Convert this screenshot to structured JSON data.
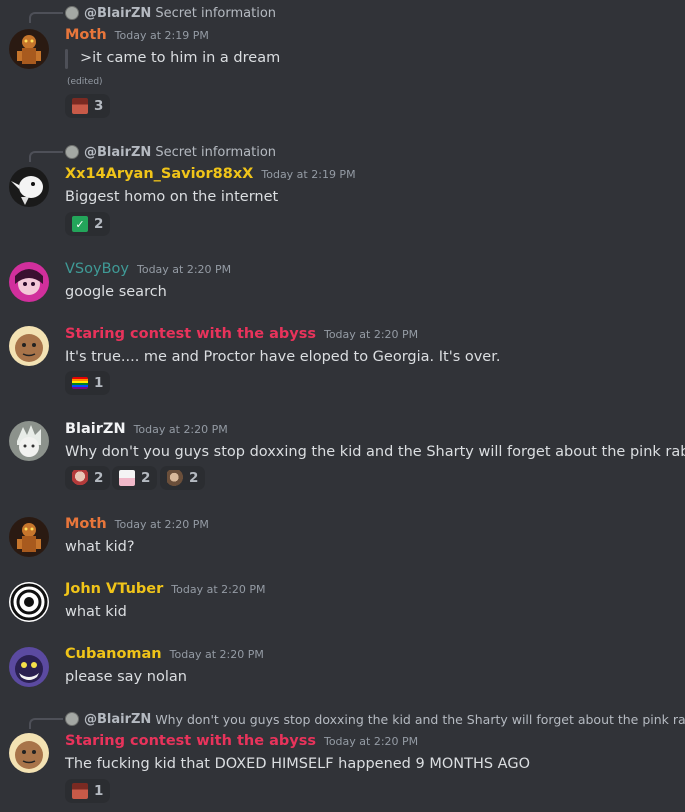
{
  "messages": [
    {
      "reply": {
        "name": "@BlairZN",
        "text": "Secret information"
      },
      "username": "Moth",
      "color": "#e8763b",
      "timestamp": "Today at 2:19 PM",
      "content": ">it came to him in a dream",
      "edited": "(edited)",
      "reactions": [
        {
          "emoji": "face-sticker-icon",
          "count": "3"
        }
      ]
    },
    {
      "reply": {
        "name": "@BlairZN",
        "text": "Secret information"
      },
      "username": "Xx14Aryan_Savior88xX",
      "color": "#f0c419",
      "timestamp": "Today at 2:19 PM",
      "content": "Biggest homo on the internet",
      "reactions": [
        {
          "emoji": "check-mark-icon",
          "count": "2"
        }
      ]
    },
    {
      "username": "VSoyBoy",
      "color": "#3f9a96",
      "timestamp": "Today at 2:20 PM",
      "content": "google search"
    },
    {
      "username": "Staring contest with the abyss",
      "color": "#e8335b",
      "timestamp": "Today at 2:20 PM",
      "content": "It's true.... me and Proctor have eloped to Georgia. It's over.",
      "reactions": [
        {
          "emoji": "rainbow-flag-icon",
          "count": "1"
        }
      ]
    },
    {
      "username": "BlairZN",
      "color": "#dbdee1",
      "timestamp": "Today at 2:20 PM",
      "content": "Why don't you guys stop doxxing the kid and the Sharty will forget about the pink rabbit",
      "reactions": [
        {
          "emoji": "anime-sticker-icon",
          "count": "2"
        },
        {
          "emoji": "pink-rabbit-sticker-icon",
          "count": "2"
        },
        {
          "emoji": "pointing-sticker-icon",
          "count": "2"
        }
      ]
    },
    {
      "username": "Moth",
      "color": "#e8763b",
      "timestamp": "Today at 2:20 PM",
      "content": "what kid?"
    },
    {
      "username": "John VTuber",
      "color": "#f0c419",
      "timestamp": "Today at 2:20 PM",
      "content": "what kid"
    },
    {
      "username": "Cubanoman",
      "color": "#f0c419",
      "timestamp": "Today at 2:20 PM",
      "content": "please say nolan"
    },
    {
      "reply": {
        "name": "@BlairZN",
        "text": "Why don't you guys stop doxxing the kid and the Sharty will forget about the pink rabbit"
      },
      "username": "Staring contest with the abyss",
      "color": "#e8335b",
      "timestamp": "Today at 2:20 PM",
      "content": "The fucking kid that DOXED HIMSELF happened 9 MONTHS AGO",
      "reactions": [
        {
          "emoji": "face-sticker-icon",
          "count": "1"
        }
      ]
    }
  ]
}
